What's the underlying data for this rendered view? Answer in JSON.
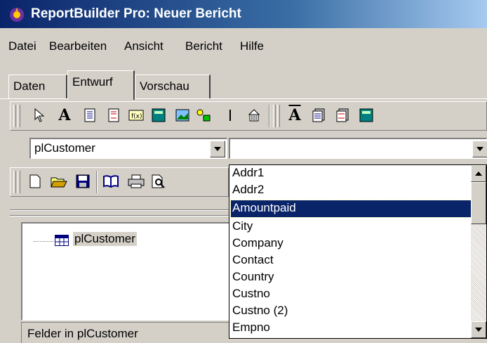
{
  "window": {
    "title": "ReportBuilder Pro: Neuer Bericht"
  },
  "menu": [
    "Datei",
    "Bearbeiten",
    "Ansicht",
    "Bericht",
    "Hilfe"
  ],
  "tabs": [
    "Daten",
    "Entwurf",
    "Vorschau"
  ],
  "active_tab": "Entwurf",
  "combo_pipeline": {
    "value": "plCustomer"
  },
  "combo_field": {
    "value": ""
  },
  "tree": {
    "root_label": "plCustomer"
  },
  "fields_label": "Felder in plCustomer",
  "dropdown": {
    "items": [
      "Addr1",
      "Addr2",
      "Amountpaid",
      "City",
      "Company",
      "Contact",
      "Country",
      "Custno",
      "Custno (2)",
      "Empno"
    ],
    "selected": "Amountpaid"
  },
  "colors": {
    "selection": "#0a246a",
    "titlebar": "#0a246a",
    "face": "#d4d0c8"
  }
}
